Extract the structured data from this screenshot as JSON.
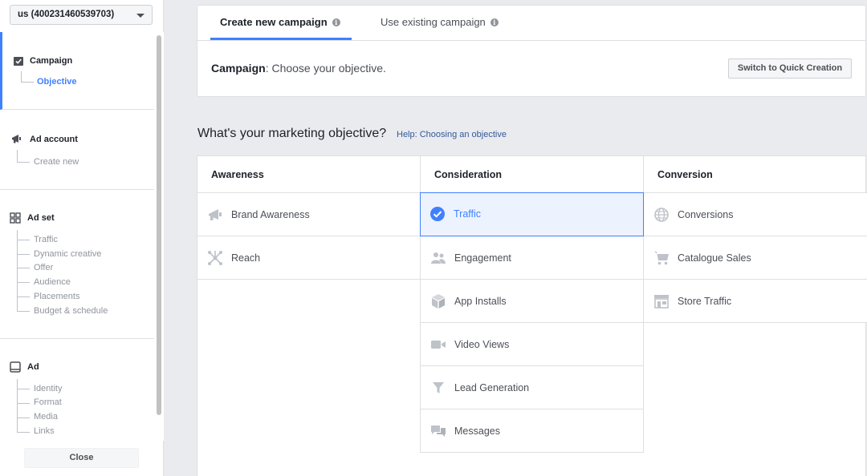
{
  "account": {
    "label": "us (400231460539703)"
  },
  "sidebar": {
    "sections": [
      {
        "title": "Campaign",
        "items": [
          "Objective"
        ]
      },
      {
        "title": "Ad account",
        "items": [
          "Create new"
        ]
      },
      {
        "title": "Ad set",
        "items": [
          "Traffic",
          "Dynamic creative",
          "Offer",
          "Audience",
          "Placements",
          "Budget & schedule"
        ]
      },
      {
        "title": "Ad",
        "items": [
          "Identity",
          "Format",
          "Media",
          "Links"
        ]
      }
    ],
    "close_label": "Close"
  },
  "tabs": [
    {
      "label": "Create new campaign",
      "active": true
    },
    {
      "label": "Use existing campaign",
      "active": false
    }
  ],
  "campaign": {
    "prefix": "Campaign",
    "text": ": Choose your objective."
  },
  "quick_creation_label": "Switch to Quick Creation",
  "question": "What's your marketing objective?",
  "help_link": "Help: Choosing an objective",
  "columns": [
    {
      "title": "Awareness",
      "items": [
        {
          "label": "Brand Awareness",
          "icon": "megaphone-icon"
        },
        {
          "label": "Reach",
          "icon": "reach-icon"
        }
      ]
    },
    {
      "title": "Consideration",
      "items": [
        {
          "label": "Traffic",
          "icon": "check-circle-icon",
          "selected": true
        },
        {
          "label": "Engagement",
          "icon": "people-icon"
        },
        {
          "label": "App Installs",
          "icon": "box-icon"
        },
        {
          "label": "Video Views",
          "icon": "video-camera-icon"
        },
        {
          "label": "Lead Generation",
          "icon": "funnel-icon"
        },
        {
          "label": "Messages",
          "icon": "chat-bubbles-icon"
        }
      ]
    },
    {
      "title": "Conversion",
      "items": [
        {
          "label": "Conversions",
          "icon": "globe-icon"
        },
        {
          "label": "Catalogue Sales",
          "icon": "cart-icon"
        },
        {
          "label": "Store Traffic",
          "icon": "store-icon"
        }
      ]
    }
  ],
  "colors": {
    "accent": "#4080ff",
    "link": "#365899",
    "icon_gray": "#bec2c9",
    "selected_bg": "#ecf3ff"
  }
}
